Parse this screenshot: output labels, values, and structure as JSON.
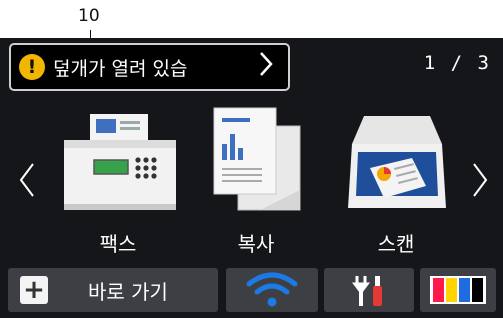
{
  "callout": {
    "number": "10"
  },
  "status": {
    "message": "덮개가 열려 있습",
    "warning_icon": "exclamation-icon",
    "warning_color": "#f2b600"
  },
  "pagination": {
    "indicator": "1 / 3"
  },
  "nav": {
    "left": "‹",
    "right": "›"
  },
  "apps": [
    {
      "label": "팩스",
      "icon": "fax-icon"
    },
    {
      "label": "복사",
      "icon": "copy-icon"
    },
    {
      "label": "스캔",
      "icon": "scan-icon"
    }
  ],
  "bottom_bar": {
    "shortcut_label": "바로 가기",
    "shortcut_icon": "plus-icon",
    "wifi_icon": "wifi-icon",
    "settings_icon": "tools-icon",
    "toner_icon": "toner-icon",
    "toner_colors": [
      "#ff1a4b",
      "#ffd400",
      "#1f6be0",
      "#000000"
    ]
  },
  "colors": {
    "screen_bg": "#14161a",
    "button_bg": "#3d3f44",
    "accent_blue": "#1c7ae6"
  }
}
